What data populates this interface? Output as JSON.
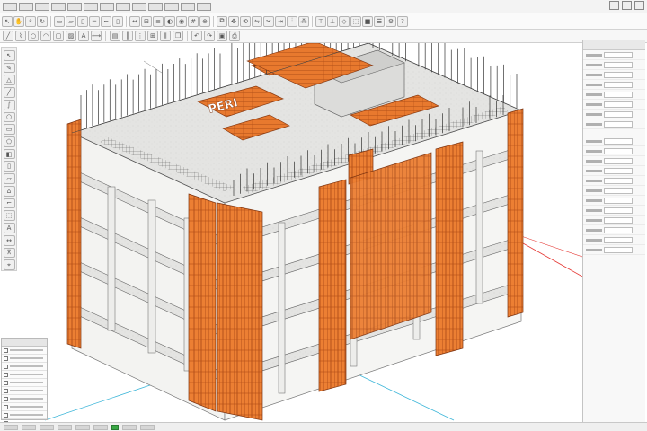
{
  "app": {
    "title": "",
    "title_glyph": "▪"
  },
  "viewport": {
    "model_label": "PERI",
    "formwork_color": "#e8792e",
    "concrete_color": "#e6e6e6",
    "axis_colors": {
      "red": "#e53935",
      "cyan": "#3fb7d9"
    }
  },
  "toolbar_icons": [
    "select-icon",
    "pan-icon",
    "zoom-icon",
    "orbit-icon",
    "wall-icon",
    "slab-icon",
    "column-icon",
    "beam-icon",
    "measure-icon",
    "section-icon",
    "layer-icon",
    "render-icon"
  ],
  "status": {
    "indicator_color": "#39a845"
  }
}
